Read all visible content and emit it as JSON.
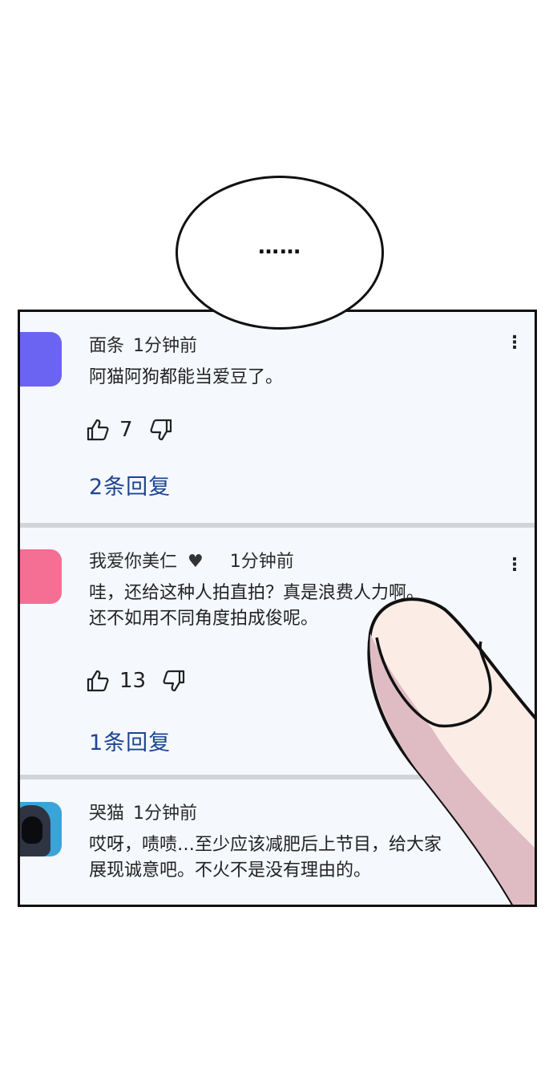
{
  "bubble": {
    "text": "……"
  },
  "comments": [
    {
      "user": "面条",
      "time": "1分钟前",
      "text_lines": [
        "阿猫阿狗都能当爱豆了。"
      ],
      "likes": "7",
      "replies": "2条回复",
      "avatar_color": "#6b64f2"
    },
    {
      "user": "我爱你美仁",
      "heart": "♥",
      "time": "1分钟前",
      "text_lines": [
        "哇，还给这种人拍直拍？真是浪费人力啊。",
        "还不如用不同角度拍成俊呢。"
      ],
      "likes": "13",
      "replies": "1条回复",
      "avatar_color": "#f56e93"
    },
    {
      "user": "哭猫",
      "time": "1分钟前",
      "text_lines": [
        "哎呀，啧啧…至少应该减肥后上节目，给大家",
        "展现诚意吧。不火不是没有理由的。"
      ],
      "avatar_color": "#3aa4d9"
    }
  ],
  "icons": {
    "more": "⋮",
    "thumb_up": "thumb-up-icon",
    "thumb_down": "thumb-down-icon"
  },
  "colors": {
    "reply_link": "#1f4590",
    "comment_bg": "#f5f8fd",
    "finger": "#fcece6",
    "finger_shadow": "#dfbcc4"
  }
}
